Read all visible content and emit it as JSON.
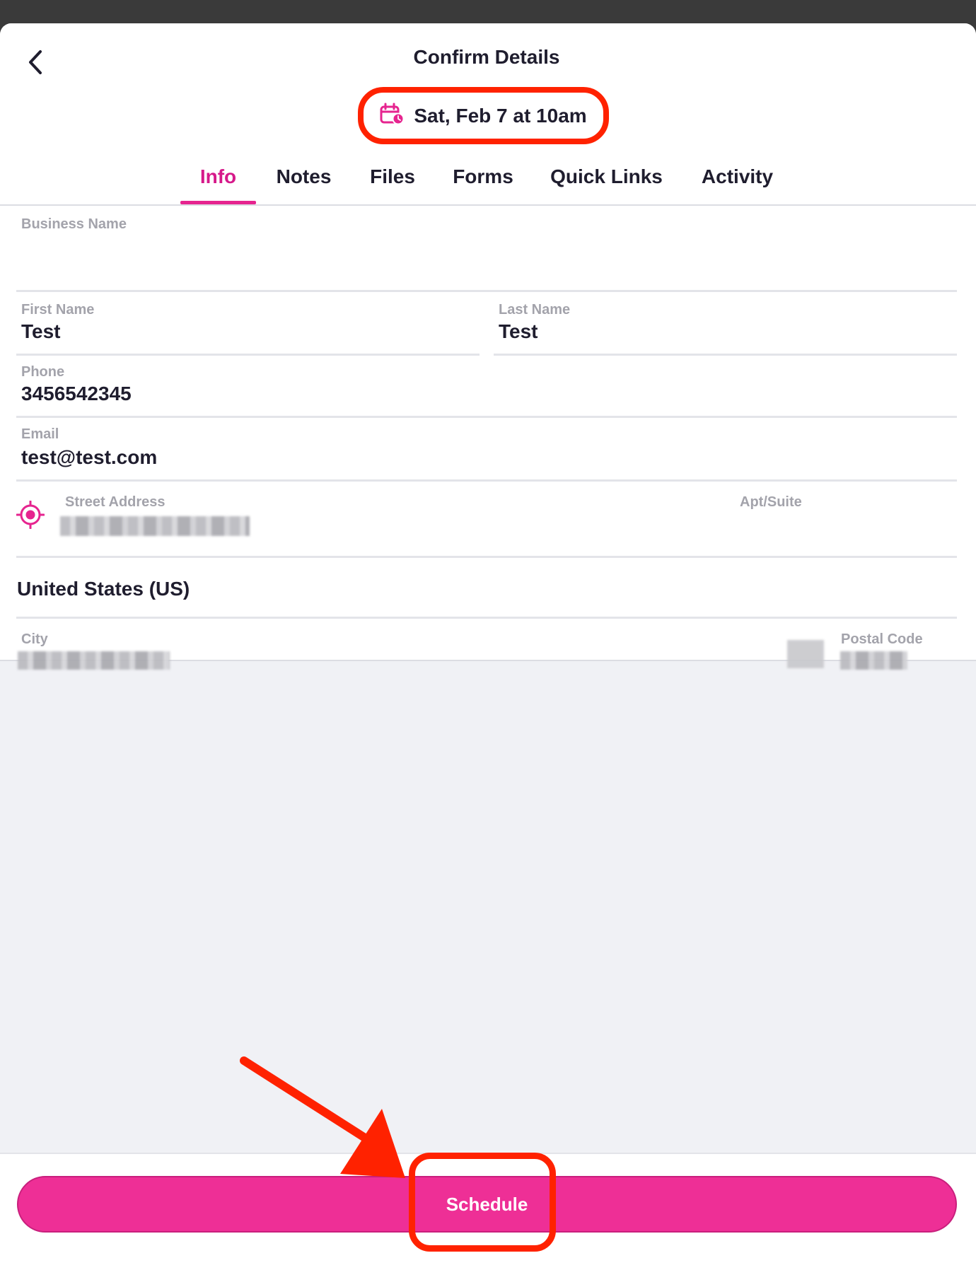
{
  "header": {
    "title": "Confirm Details",
    "date": "Sat, Feb 7 at 10am"
  },
  "tabs": [
    {
      "label": "Info",
      "active": true
    },
    {
      "label": "Notes",
      "active": false
    },
    {
      "label": "Files",
      "active": false
    },
    {
      "label": "Forms",
      "active": false
    },
    {
      "label": "Quick Links",
      "active": false
    },
    {
      "label": "Activity",
      "active": false
    }
  ],
  "form": {
    "business_name": {
      "label": "Business Name",
      "value": ""
    },
    "first_name": {
      "label": "First Name",
      "value": "Test"
    },
    "last_name": {
      "label": "Last Name",
      "value": "Test"
    },
    "phone": {
      "label": "Phone",
      "value": "3456542345"
    },
    "email": {
      "label": "Email",
      "value": "test@test.com"
    },
    "street_address": {
      "label": "Street Address"
    },
    "apt_suite": {
      "label": "Apt/Suite"
    },
    "country": {
      "value": "United States (US)"
    },
    "city": {
      "label": "City"
    },
    "postal_code": {
      "label": "Postal Code"
    }
  },
  "footer": {
    "schedule_label": "Schedule"
  },
  "colors": {
    "accent": "#ee2f96",
    "active_tab": "#d6198a",
    "annotation": "#ff2200"
  },
  "icons": {
    "back": "chevron-left-icon",
    "date": "calendar-clock-icon",
    "locate": "location-target-icon"
  }
}
